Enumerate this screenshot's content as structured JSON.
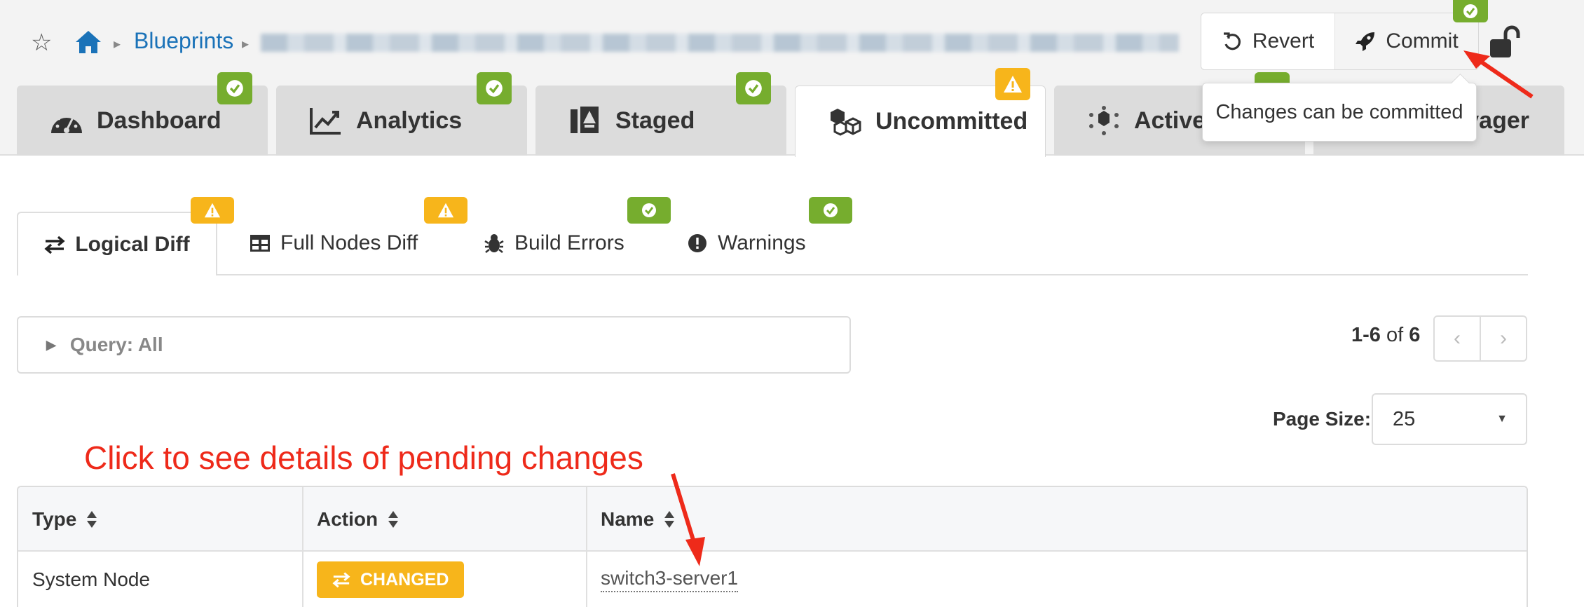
{
  "breadcrumb": {
    "link": "Blueprints"
  },
  "header_actions": {
    "revert_label": "Revert",
    "commit_label": "Commit"
  },
  "tooltip": {
    "text": "Changes can be committed"
  },
  "main_tabs": [
    {
      "label": "Dashboard",
      "icon": "gauge-icon",
      "status": "ok"
    },
    {
      "label": "Analytics",
      "icon": "chart-line-icon",
      "status": "ok"
    },
    {
      "label": "Staged",
      "icon": "staged-icon",
      "status": "ok"
    },
    {
      "label": "Uncommitted",
      "icon": "cubes-icon",
      "status": "warning"
    },
    {
      "label": "Active",
      "icon": "active-icon",
      "status": "ok"
    },
    {
      "label": "yager",
      "icon": "",
      "status": ""
    }
  ],
  "sub_tabs": [
    {
      "label": "Logical Diff",
      "icon": "exchange-icon",
      "status": "warning"
    },
    {
      "label": "Full Nodes Diff",
      "icon": "table-icon",
      "status": "warning"
    },
    {
      "label": "Build Errors",
      "icon": "bug-icon",
      "status": "ok"
    },
    {
      "label": "Warnings",
      "icon": "exclamation-icon",
      "status": "ok"
    }
  ],
  "query": {
    "label": "Query: All"
  },
  "pagination": {
    "range": "1-6",
    "of_word": "of",
    "total": "6"
  },
  "page_size": {
    "label": "Page Size:",
    "value": "25"
  },
  "annotation": {
    "text": "Click to see details of pending changes"
  },
  "table": {
    "columns": [
      "Type",
      "Action",
      "Name"
    ],
    "rows": [
      {
        "type": "System Node",
        "action": "CHANGED",
        "name": "switch3-server1"
      }
    ]
  },
  "colors": {
    "link": "#1a72b8",
    "ok": "#76ad2e",
    "warning": "#f7b51b",
    "annotation": "#ee2a1a"
  }
}
